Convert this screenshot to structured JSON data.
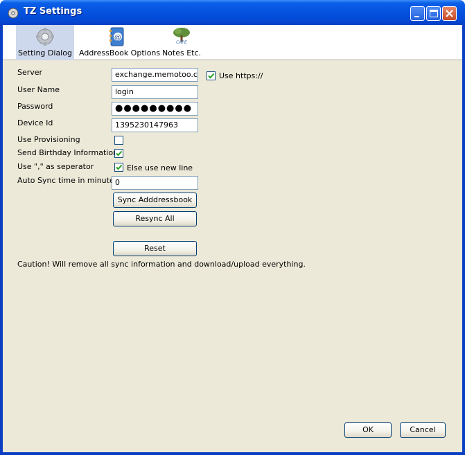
{
  "window": {
    "title": "TZ Settings"
  },
  "toolbar": {
    "items": [
      {
        "label": "Setting Dialog",
        "icon": "gear-icon",
        "selected": true
      },
      {
        "label": "AddressBook Options",
        "icon": "address-book-icon",
        "selected": false
      },
      {
        "label": "Notes Etc.",
        "icon": "tree-icon",
        "selected": false
      }
    ],
    "icon_caption": "CAPE"
  },
  "form": {
    "server_label": "Server",
    "server_value": "exchange.memotoo.com",
    "https_label": "Use https://",
    "https_checked": true,
    "username_label": "User Name",
    "username_value": "login",
    "password_label": "Password",
    "password_value": "●●●●●●●●●",
    "device_label": "Device Id",
    "device_value": "1395230147963",
    "provisioning_label": "Use Provisioning",
    "provisioning_checked": false,
    "birthday_label": "Send Birthday Information",
    "birthday_checked": true,
    "separator_label": "Use \",\" as seperator",
    "separator_checked": true,
    "separator_else_label": "Else use new line",
    "autosync_label": "Auto Sync time in minutes",
    "autosync_value": "0"
  },
  "buttons": {
    "sync": "Sync Adddressbook",
    "resync": "Resync All",
    "reset": "Reset",
    "ok": "OK",
    "cancel": "Cancel"
  },
  "caution": "Caution! Will remove all sync information and download/upload everything.",
  "colors": {
    "titlebar": "#0553e0",
    "client_bg": "#ece9d8",
    "check": "#21a121"
  }
}
